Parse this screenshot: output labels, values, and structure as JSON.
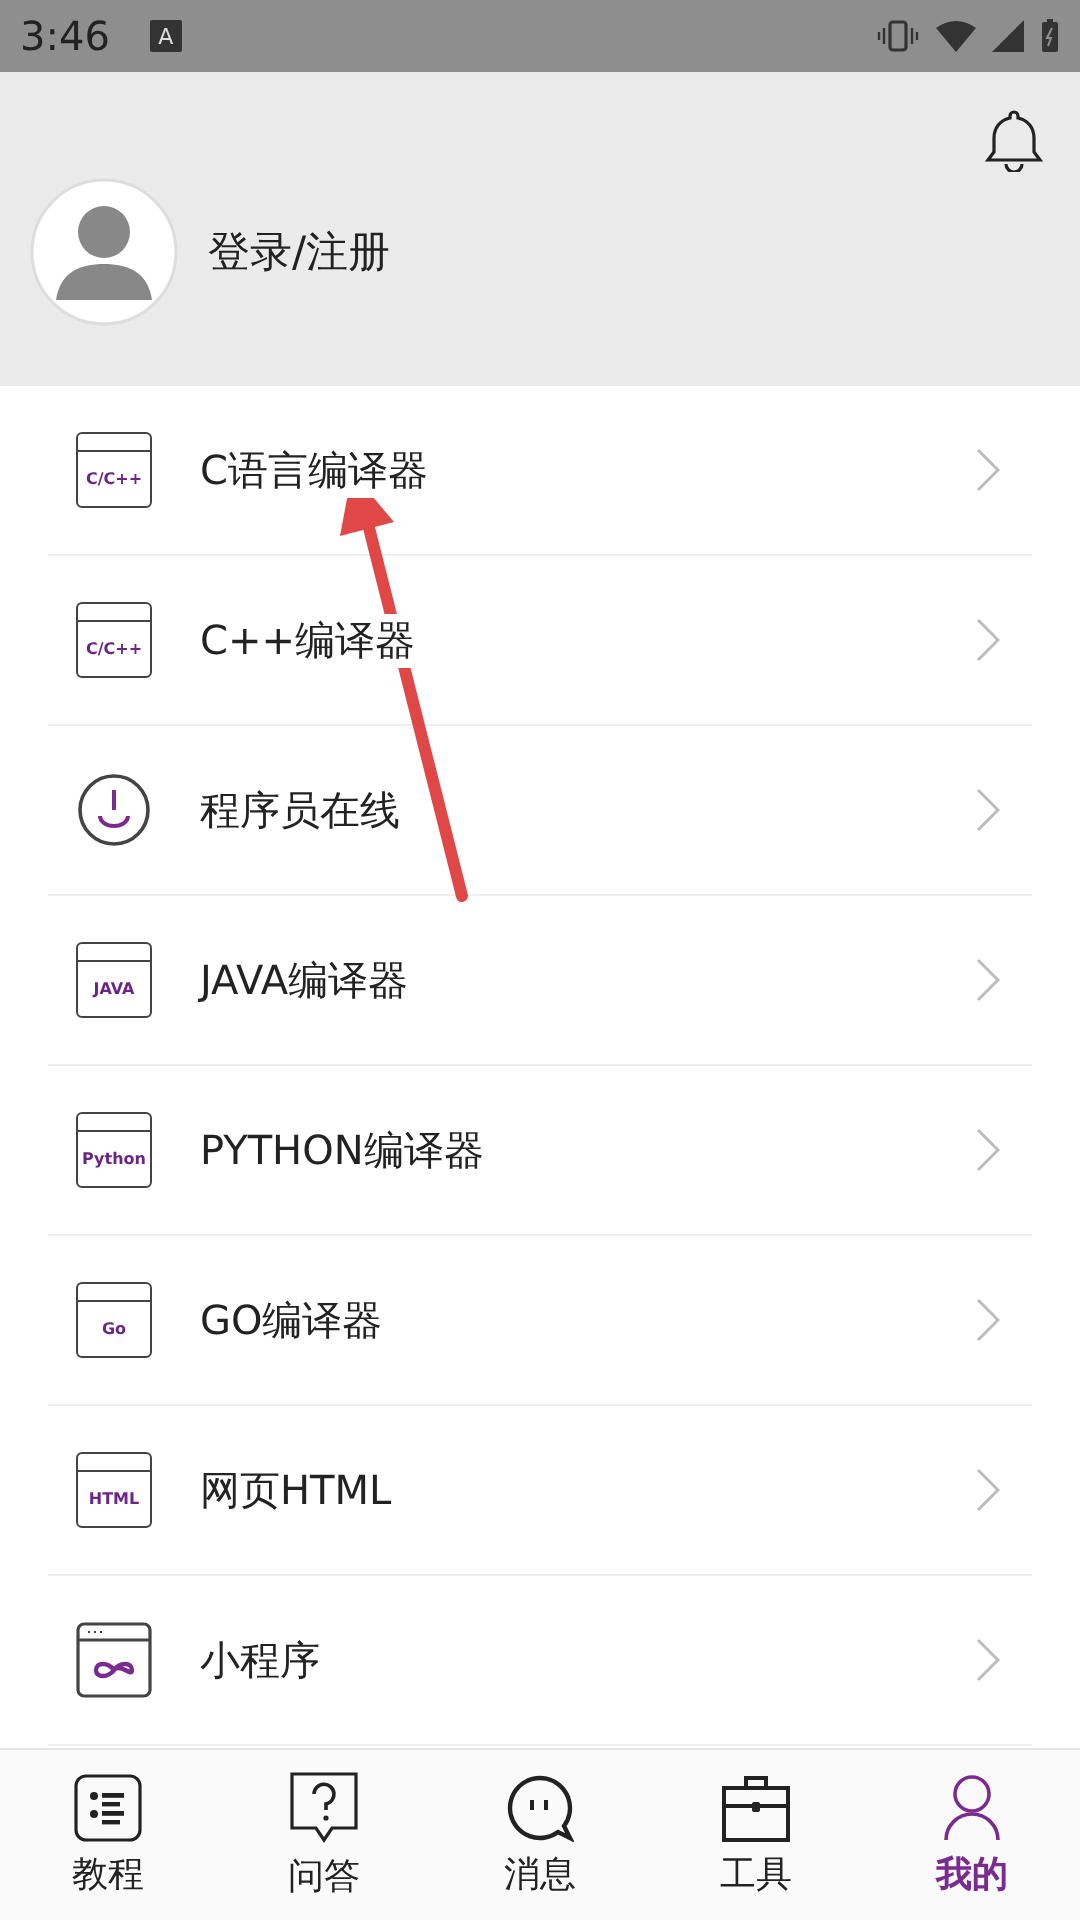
{
  "status_bar": {
    "time": "3:46",
    "keyboard_indicator": "A"
  },
  "profile": {
    "login_label": "登录/注册"
  },
  "menu_items": [
    {
      "label": "C语言编译器",
      "kind": "window-text",
      "icon_text": "C/C++"
    },
    {
      "label": "C++编译器",
      "kind": "window-text",
      "icon_text": "C/C++"
    },
    {
      "label": "程序员在线",
      "kind": "power"
    },
    {
      "label": "JAVA编译器",
      "kind": "window-text",
      "icon_text": "JAVA"
    },
    {
      "label": "PYTHON编译器",
      "kind": "window-text",
      "icon_text": "Python"
    },
    {
      "label": "GO编译器",
      "kind": "window-text",
      "icon_text": "Go"
    },
    {
      "label": "网页HTML",
      "kind": "window-text",
      "icon_text": "HTML"
    },
    {
      "label": "小程序",
      "kind": "window-infinity"
    }
  ],
  "bottom_nav": [
    {
      "label": "教程",
      "kind": "list",
      "selected": false
    },
    {
      "label": "问答",
      "kind": "question",
      "selected": false
    },
    {
      "label": "消息",
      "kind": "chat",
      "selected": false
    },
    {
      "label": "工具",
      "kind": "toolbox",
      "selected": false
    },
    {
      "label": "我的",
      "kind": "person",
      "selected": true
    }
  ]
}
